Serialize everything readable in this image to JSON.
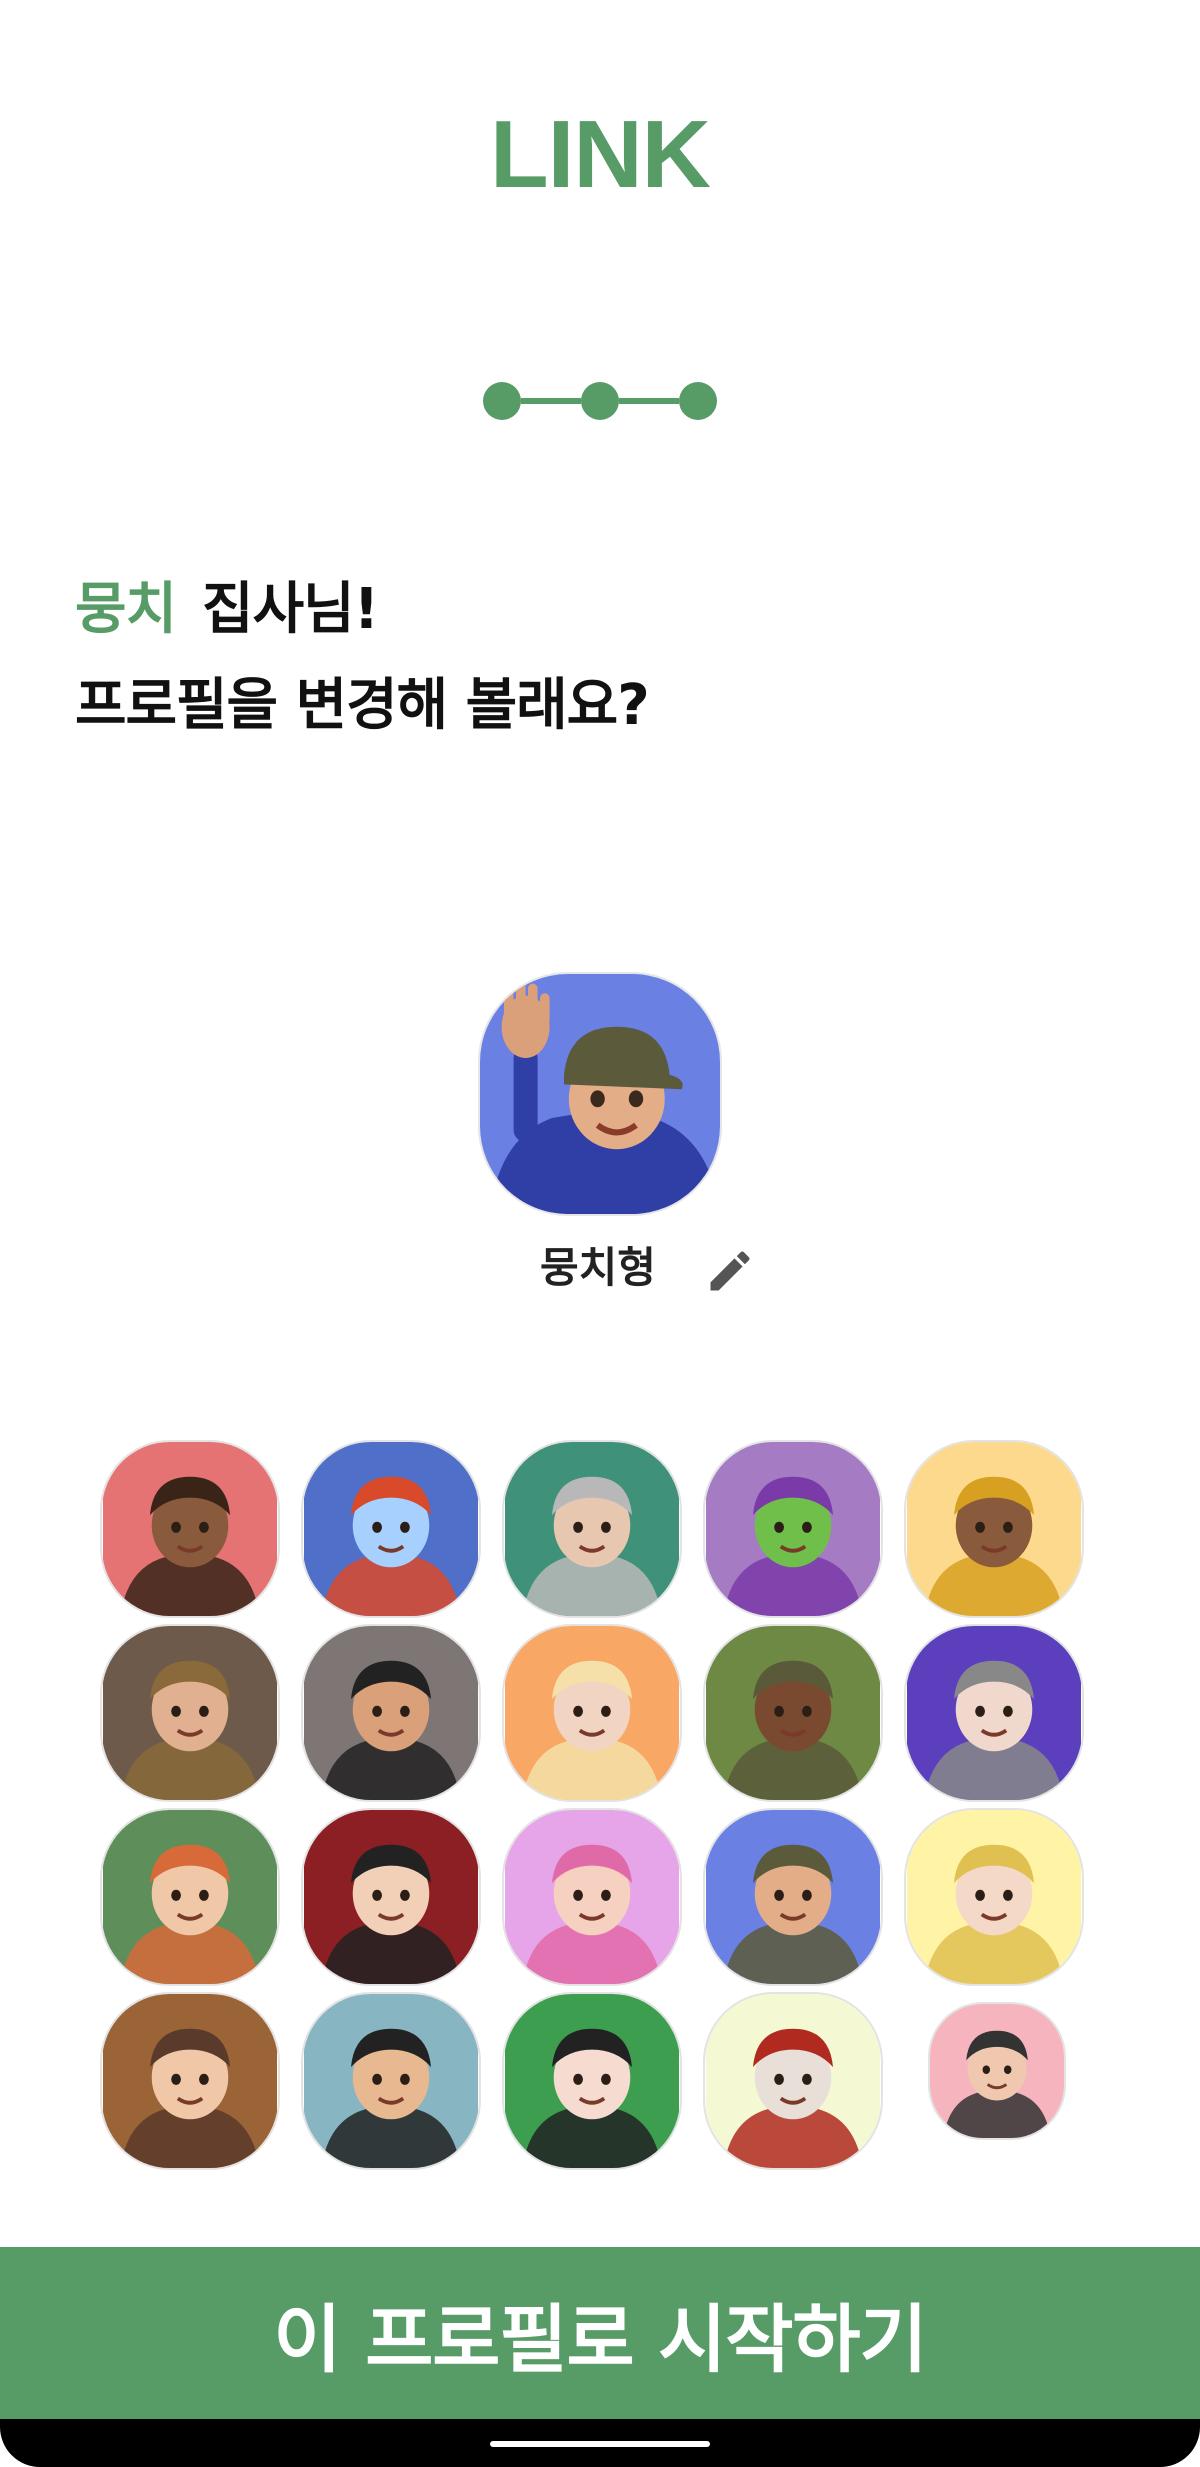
{
  "header": {
    "app_title": "LINK"
  },
  "stepper": {
    "total_steps": 3,
    "completed_steps": 3
  },
  "greeting": {
    "name": "뭉치",
    "suffix": "집사님!",
    "question": "프로필을 변경해 볼래요?"
  },
  "profile": {
    "avatar_icon": "memoji-waving-cap-icon",
    "avatar_bg": "#6a80e3",
    "nickname": "뭉치형",
    "edit_icon": "pencil-icon"
  },
  "avatars": [
    {
      "icon": "memoji-cross-arms-icon",
      "bg": "#e57373"
    },
    {
      "icon": "memoji-blue-mohawk-icon",
      "bg": "#4f6fc8"
    },
    {
      "icon": "memoji-grey-beard-icon",
      "bg": "#3f9179"
    },
    {
      "icon": "memoji-green-shocked-icon",
      "bg": "#a57bc4"
    },
    {
      "icon": "memoji-yellow-beanie-icon",
      "bg": "#fcd98c"
    },
    {
      "icon": "memoji-laptop-icon",
      "bg": "#6e5a4b"
    },
    {
      "icon": "memoji-black-beanie-icon",
      "bg": "#7d7675"
    },
    {
      "icon": "memoji-blonde-bangs-icon",
      "bg": "#f8a765"
    },
    {
      "icon": "memoji-thumbs-down-icon",
      "bg": "#6e8943"
    },
    {
      "icon": "memoji-space-buns-icon",
      "bg": "#5b3fbd"
    },
    {
      "icon": "memoji-shrug-redhead-icon",
      "bg": "#5e8f5a"
    },
    {
      "icon": "memoji-tongue-out-icon",
      "bg": "#8b1f23"
    },
    {
      "icon": "memoji-hearts-icon",
      "bg": "#e6a4e9"
    },
    {
      "icon": "memoji-waving-cap-icon",
      "bg": "#6a80e3"
    },
    {
      "icon": "memoji-crown-shrug-icon",
      "bg": "#fff3a5"
    },
    {
      "icon": "memoji-thinking-icon",
      "bg": "#9a6437"
    },
    {
      "icon": "memoji-nervous-icon",
      "bg": "#87b5c2"
    },
    {
      "icon": "memoji-jester-hat-icon",
      "bg": "#3d9e4f"
    },
    {
      "icon": "memoji-red-hat-icon",
      "bg": "#f4f9d4"
    },
    {
      "icon": "memoji-glasses-face-icon",
      "bg": "#f6b5be"
    }
  ],
  "cta": {
    "label": "이 프로필로 시작하기"
  },
  "colors": {
    "brand": "#579b66",
    "text": "#111111",
    "button_text": "#ffffff"
  }
}
